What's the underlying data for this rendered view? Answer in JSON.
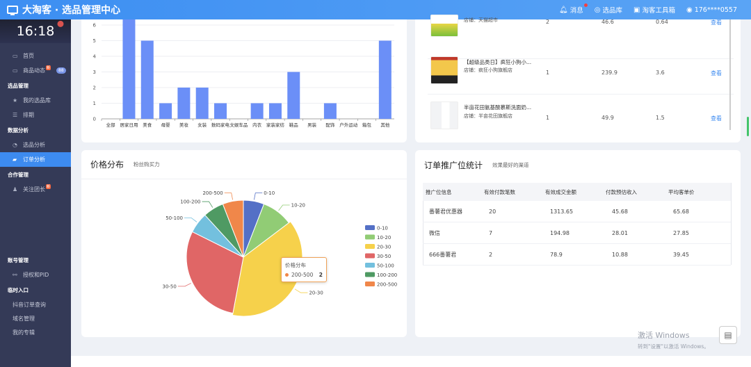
{
  "header": {
    "brand": "大淘客 · 选品管理中心",
    "nav": [
      {
        "icon": "bell-icon",
        "label": "消息"
      },
      {
        "icon": "compass-icon",
        "label": "选品库"
      },
      {
        "icon": "toolbox-icon",
        "label": "淘客工具箱"
      },
      {
        "icon": "user-icon",
        "label": "176****0557"
      }
    ]
  },
  "sidebar": {
    "clock": "16:18",
    "home": "首页",
    "feed": "商品动态",
    "feed_count": "88",
    "new_tag": "新",
    "group_select": "选品管理",
    "my_lib": "我的选品库",
    "rank": "排期",
    "group_data": "数据分析",
    "select_analysis": "选品分析",
    "order_analysis": "订单分析",
    "group_coop": "合作管理",
    "follow_team": "关注团长",
    "group_account": "账号管理",
    "auth_pid": "授权和PID",
    "group_temp": "临时入口",
    "douyin": "抖音订单查询",
    "domain": "域名管理",
    "my_column": "我的专辑"
  },
  "goods": {
    "rows": [
      {
        "name": "",
        "shop": "店铺：天猫超市",
        "count": "2",
        "price": "46.6",
        "commission": "0.64",
        "action": "查看"
      },
      {
        "name": "【超级品类日】疯狂小狗小...",
        "shop": "店铺：疯狂小狗旗舰店",
        "count": "1",
        "price": "239.9",
        "commission": "3.6",
        "action": "查看"
      },
      {
        "name": "半亩花田氨基酸慕斯洗面奶...",
        "shop": "店铺：半亩花田旗舰店",
        "count": "1",
        "price": "49.9",
        "commission": "1.5",
        "action": "查看"
      }
    ]
  },
  "pie_panel": {
    "title": "价格分布",
    "subtitle": "粉丝购买力"
  },
  "order_panel": {
    "title": "订单推广位统计",
    "subtitle": "效果最好的渠道",
    "headers": [
      "推广位信息",
      "有效付款笔数",
      "有效成交金额",
      "付款预估收入",
      "平均客单价"
    ],
    "rows": [
      [
        "番薯君优惠器",
        "20",
        "1313.65",
        "45.68",
        "65.68"
      ],
      [
        "微信",
        "7",
        "194.98",
        "28.01",
        "27.85"
      ],
      [
        "666番薯君",
        "2",
        "78.9",
        "10.88",
        "39.45"
      ]
    ]
  },
  "tooltip": {
    "title": "价格分布",
    "label": "200-500",
    "value": "2"
  },
  "watermark": {
    "line1": "激活 Windows",
    "line2": "转到\"设置\"以激活 Windows。"
  },
  "chart_data": [
    {
      "type": "bar",
      "categories": [
        "全部",
        "居家日用",
        "美食",
        "母婴",
        "美妆",
        "女装",
        "数码家电",
        "文娱车品",
        "内衣",
        "家装家纺",
        "鞋品",
        "男装",
        "配饰",
        "户外运动",
        "箱包",
        "其他"
      ],
      "values": [
        0,
        7,
        5,
        1,
        2,
        2,
        1,
        0,
        1,
        1,
        3,
        0,
        1,
        0,
        0,
        5
      ],
      "y_ticks": [
        "0",
        "1",
        "2",
        "3",
        "4",
        "5",
        "6"
      ],
      "ylim": [
        0,
        6.6
      ],
      "grid": true,
      "color": "#6b8ff7"
    },
    {
      "type": "pie",
      "labels": [
        "0-10",
        "10-20",
        "20-30",
        "30-50",
        "50-100",
        "100-200",
        "200-500"
      ],
      "values": [
        2,
        3,
        13,
        10,
        2,
        2,
        2
      ],
      "colors": [
        "#5470c6",
        "#91cc75",
        "#f6d14b",
        "#e06666",
        "#73c0de",
        "#4f9a63",
        "#f0874a"
      ],
      "legend": "right",
      "highlight": "20-30"
    }
  ]
}
